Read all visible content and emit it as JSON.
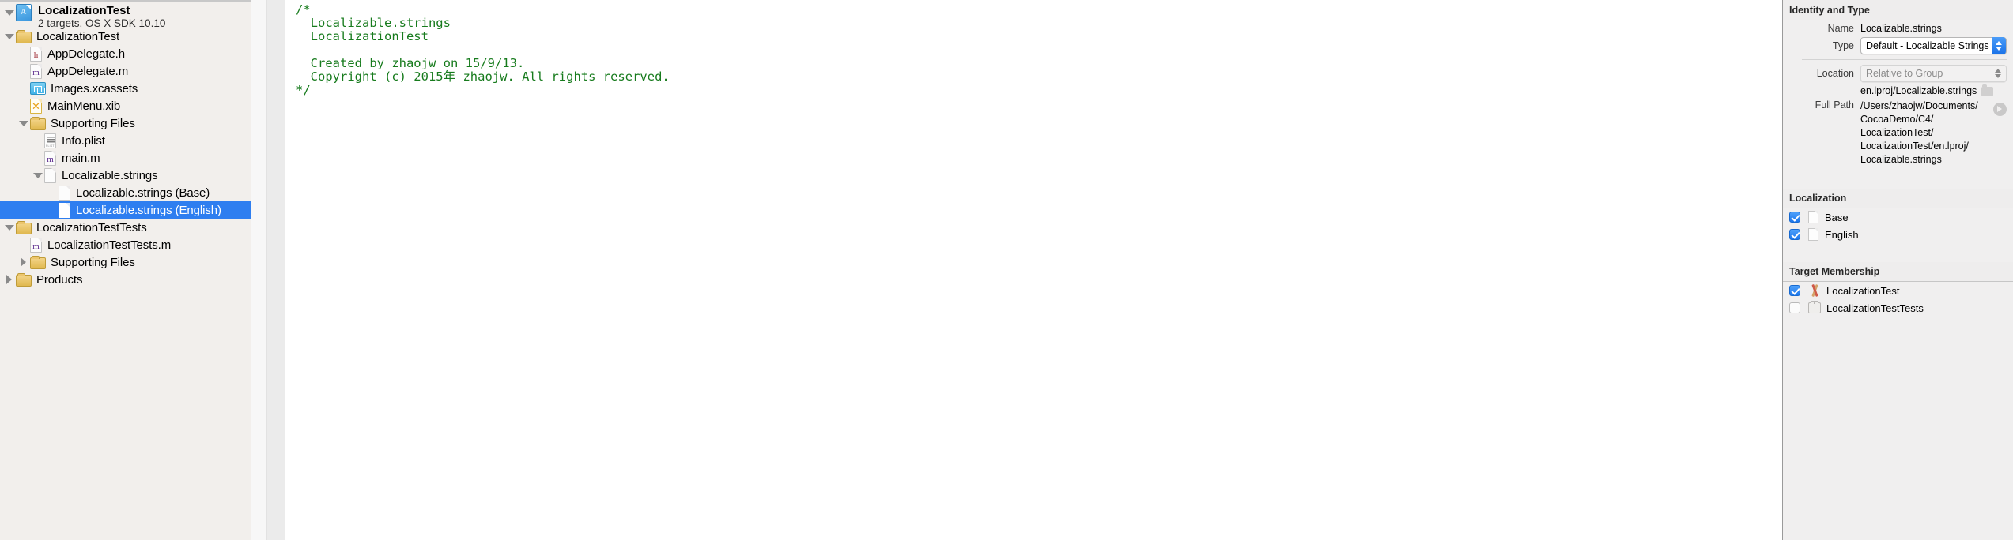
{
  "navigator": {
    "project": {
      "title": "LocalizationTest",
      "subtitle": "2 targets, OS X SDK 10.10",
      "icon": "xcode-project-icon"
    },
    "items": [
      {
        "label": "LocalizationTest",
        "icon": "folder-icon",
        "indent": 1,
        "twisty": "open",
        "selected": false
      },
      {
        "label": "AppDelegate.h",
        "icon": "header-file-icon",
        "indent": 2,
        "twisty": "none",
        "selected": false
      },
      {
        "label": "AppDelegate.m",
        "icon": "objc-file-icon",
        "indent": 2,
        "twisty": "none",
        "selected": false
      },
      {
        "label": "Images.xcassets",
        "icon": "assets-icon",
        "indent": 2,
        "twisty": "none",
        "selected": false
      },
      {
        "label": "MainMenu.xib",
        "icon": "xib-icon",
        "indent": 2,
        "twisty": "none",
        "selected": false
      },
      {
        "label": "Supporting Files",
        "icon": "folder-icon",
        "indent": 2,
        "twisty": "open",
        "selected": false
      },
      {
        "label": "Info.plist",
        "icon": "plist-icon",
        "indent": 3,
        "twisty": "none",
        "selected": false
      },
      {
        "label": "main.m",
        "icon": "objc-file-icon",
        "indent": 3,
        "twisty": "none",
        "selected": false
      },
      {
        "label": "Localizable.strings",
        "icon": "strings-file-icon",
        "indent": 3,
        "twisty": "open",
        "selected": false
      },
      {
        "label": "Localizable.strings (Base)",
        "icon": "strings-file-icon",
        "indent": 4,
        "twisty": "none",
        "selected": false
      },
      {
        "label": "Localizable.strings (English)",
        "icon": "strings-file-icon",
        "indent": 4,
        "twisty": "none",
        "selected": true
      },
      {
        "label": "LocalizationTestTests",
        "icon": "folder-icon",
        "indent": 1,
        "twisty": "open",
        "selected": false
      },
      {
        "label": "LocalizationTestTests.m",
        "icon": "objc-file-icon",
        "indent": 2,
        "twisty": "none",
        "selected": false
      },
      {
        "label": "Supporting Files",
        "icon": "folder-icon",
        "indent": 2,
        "twisty": "closed",
        "selected": false
      },
      {
        "label": "Products",
        "icon": "folder-icon",
        "indent": 1,
        "twisty": "closed",
        "selected": false
      }
    ],
    "selection_color": "#2e7ef0"
  },
  "editor": {
    "comment_color": "#177b1d",
    "lines": [
      "/*",
      "  Localizable.strings",
      "  LocalizationTest",
      "",
      "  Created by zhaojw on 15/9/13.",
      "  Copyright (c) 2015年 zhaojw. All rights reserved.",
      "*/"
    ]
  },
  "inspector": {
    "identity": {
      "header": "Identity and Type",
      "name_label": "Name",
      "name_value": "Localizable.strings",
      "type_label": "Type",
      "type_value": "Default - Localizable Strings",
      "location_label": "Location",
      "location_value": "Relative to Group",
      "relative_path": "en.lproj/Localizable.strings",
      "full_path_label": "Full Path",
      "full_path_lines": [
        "/Users/zhaojw/Documents/",
        "CocoaDemo/C4/",
        "LocalizationTest/",
        "LocalizationTest/en.lproj/",
        "Localizable.strings"
      ]
    },
    "localization": {
      "header": "Localization",
      "items": [
        {
          "label": "Base",
          "checked": true
        },
        {
          "label": "English",
          "checked": true
        }
      ]
    },
    "target_membership": {
      "header": "Target Membership",
      "items": [
        {
          "label": "LocalizationTest",
          "checked": true,
          "icon": "app-target-icon"
        },
        {
          "label": "LocalizationTestTests",
          "checked": false,
          "icon": "test-target-icon"
        }
      ]
    }
  }
}
